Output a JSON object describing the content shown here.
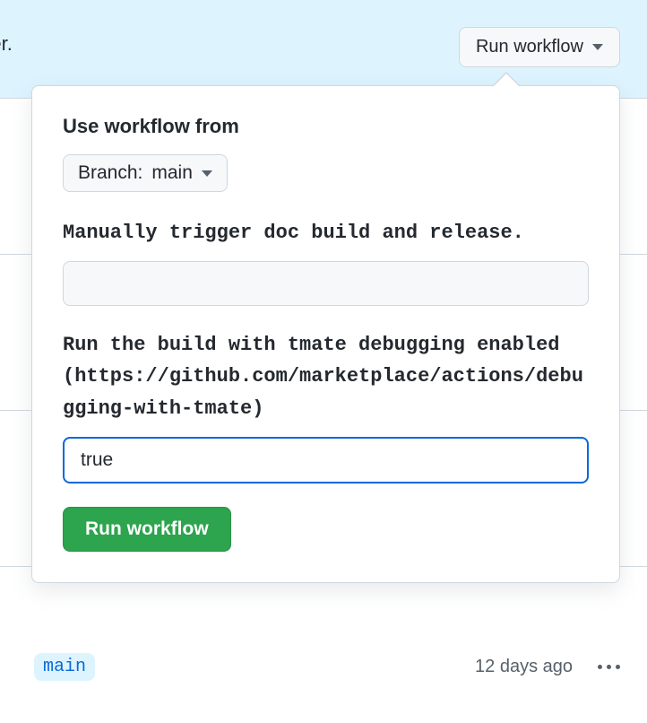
{
  "banner": {
    "text_fragment": "igger.",
    "run_button_label": "Run workflow"
  },
  "popover": {
    "use_from_label": "Use workflow from",
    "branch_prefix": "Branch:",
    "branch_name": "main",
    "input1_label": "Manually trigger doc build and release.",
    "input1_value": "",
    "input2_label": "Run the build with tmate debugging enabled (https://github.com/marketplace/actions/debugging-with-tmate)",
    "input2_value": "true",
    "submit_label": "Run workflow"
  },
  "footer": {
    "branch_tag": "main",
    "timestamp": "12 days ago"
  },
  "truncated": {
    "a": "..",
    "b": "u",
    "c": ".."
  }
}
